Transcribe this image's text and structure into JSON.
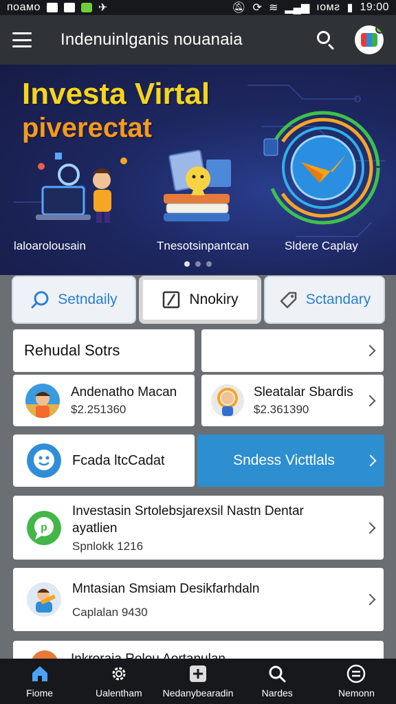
{
  "status_bar": {
    "carrier": "поамо",
    "time": "19:00",
    "network": "ıoᴍƨ"
  },
  "app_bar": {
    "title": "Indenuinlganis nouanaia"
  },
  "hero": {
    "title": "Investa Virtal",
    "subtitle": "piverectat",
    "captions": [
      "laloarolousain",
      "Tnesotsinpantcan",
      "Sldere Caplay"
    ],
    "page_count": 3,
    "active_page": 0
  },
  "quick_actions": [
    {
      "label": "Setndaily",
      "icon": "search-icon"
    },
    {
      "label": "Nnokiry",
      "icon": "note-icon"
    },
    {
      "label": "Sctandary",
      "icon": "tag-icon"
    }
  ],
  "cards": {
    "section_title": "Rehudal Sotrs",
    "item_a": {
      "title": "Andenatho Macan",
      "price": "$2.251360"
    },
    "item_b": {
      "title": "Sleatalar Sbardis",
      "price": "$2.361390"
    },
    "feedback": {
      "title": "Fcada ltcCadat"
    },
    "cta": {
      "label": "Sndess Victtlals"
    },
    "list": [
      {
        "title": "Investasin Srtolebsjarexsil Nastn Dentar ayatlien",
        "sub": "Spnlokk 1216"
      },
      {
        "title": "Mntasian Smsiam Desikfarhdaln",
        "sub": "Caplalan 9430"
      },
      {
        "title": "Inkroraia Rolou Aortanulan",
        "sub": ""
      }
    ]
  },
  "bottom_nav": [
    {
      "label": "Fiome",
      "icon": "home-icon",
      "active": true
    },
    {
      "label": "Ualentham",
      "icon": "gear-icon",
      "active": false
    },
    {
      "label": "Nedanybearadin",
      "icon": "plus-box-icon",
      "active": false
    },
    {
      "label": "Nardes",
      "icon": "search-icon",
      "active": false
    },
    {
      "label": "Nemonn",
      "icon": "menu-circle-icon",
      "active": false
    }
  ],
  "colors": {
    "accent": "#2d8fd0",
    "hero_title": "#f5d51c",
    "hero_subtitle": "#f59a1c",
    "app_bar": "#2f3237"
  }
}
